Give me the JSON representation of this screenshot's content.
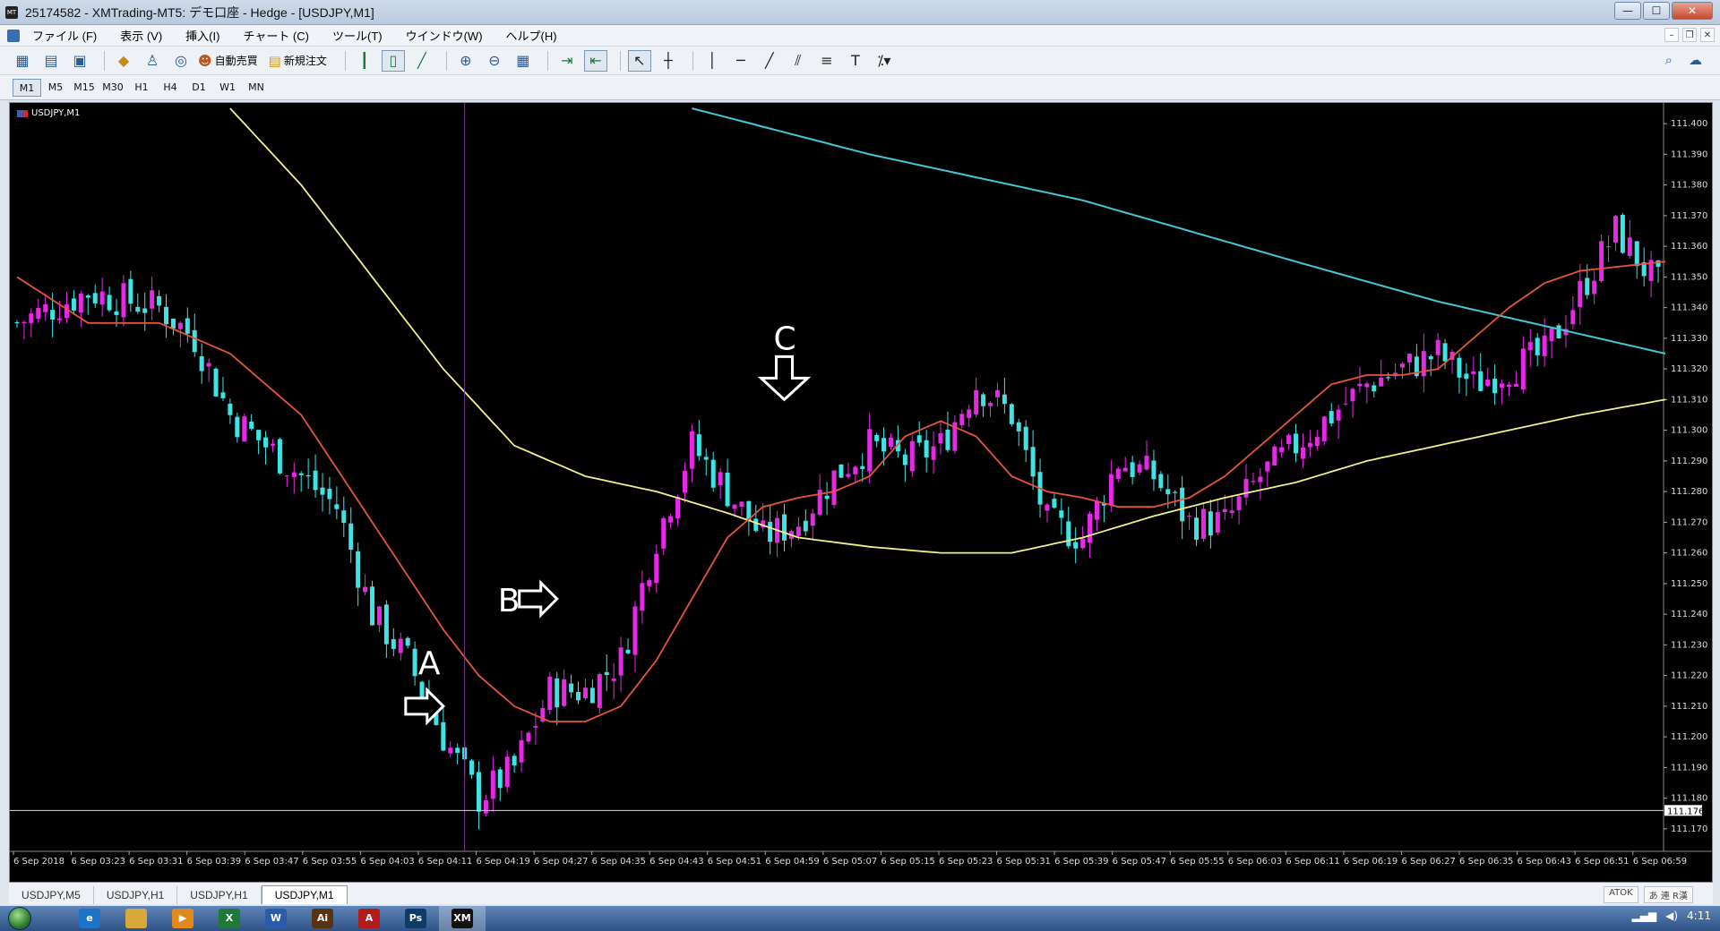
{
  "window": {
    "title": "25174582 - XMTrading-MT5: デモ口座 - Hedge - [USDJPY,M1]",
    "icon": "mt5-icon",
    "buttons": [
      "minimize",
      "maximize",
      "close"
    ]
  },
  "menu": {
    "items": [
      "ファイル (F)",
      "表示 (V)",
      "挿入(I)",
      "チャート (C)",
      "ツール(T)",
      "ウインドウ(W)",
      "ヘルプ(H)"
    ]
  },
  "toolbar": {
    "auto_trade_label": "自動売買",
    "new_order_label": "新規注文"
  },
  "timeframes": {
    "items": [
      "M1",
      "M5",
      "M15",
      "M30",
      "H1",
      "H4",
      "D1",
      "W1",
      "MN"
    ],
    "active": "M1"
  },
  "chart": {
    "label": "USDJPY,M1",
    "current_price": "111.176",
    "colors": {
      "background": "#000000",
      "bull": "#e629e6",
      "bear": "#3ee4e4",
      "ma_fast": "#e8543a",
      "ma_mid": "#f0f08c",
      "ma_slow": "#46c6d8"
    },
    "annotations": [
      {
        "label": "A",
        "arrow": "right"
      },
      {
        "label": "B",
        "arrow": "right"
      },
      {
        "label": "C",
        "arrow": "down"
      }
    ]
  },
  "chart_data": {
    "type": "candlestick",
    "y_range": [
      111.165,
      111.405
    ],
    "y_ticks": [
      "111.400",
      "111.390",
      "111.380",
      "111.370",
      "111.360",
      "111.350",
      "111.340",
      "111.330",
      "111.320",
      "111.310",
      "111.300",
      "111.290",
      "111.280",
      "111.270",
      "111.260",
      "111.250",
      "111.240",
      "111.230",
      "111.220",
      "111.210",
      "111.200",
      "111.190",
      "111.180",
      "111.170"
    ],
    "x_labels": [
      "6 Sep 2018",
      "6 Sep 03:23",
      "6 Sep 03:31",
      "6 Sep 03:39",
      "6 Sep 03:47",
      "6 Sep 03:55",
      "6 Sep 04:03",
      "6 Sep 04:11",
      "6 Sep 04:19",
      "6 Sep 04:27",
      "6 Sep 04:35",
      "6 Sep 04:43",
      "6 Sep 04:51",
      "6 Sep 04:59",
      "6 Sep 05:07",
      "6 Sep 05:15",
      "6 Sep 05:23",
      "6 Sep 05:31",
      "6 Sep 05:39",
      "6 Sep 05:47",
      "6 Sep 05:55",
      "6 Sep 06:03",
      "6 Sep 06:11",
      "6 Sep 06:19",
      "6 Sep 06:27",
      "6 Sep 06:35",
      "6 Sep 06:43",
      "6 Sep 06:51",
      "6 Sep 06:59"
    ],
    "close_trend": [
      [
        0,
        111.335
      ],
      [
        10,
        111.345
      ],
      [
        20,
        111.34
      ],
      [
        25,
        111.33
      ],
      [
        30,
        111.305
      ],
      [
        40,
        111.285
      ],
      [
        45,
        111.275
      ],
      [
        50,
        111.24
      ],
      [
        55,
        111.225
      ],
      [
        60,
        111.2
      ],
      [
        65,
        111.18
      ],
      [
        70,
        111.19
      ],
      [
        75,
        111.215
      ],
      [
        80,
        111.215
      ],
      [
        85,
        111.225
      ],
      [
        90,
        111.265
      ],
      [
        95,
        111.295
      ],
      [
        100,
        111.28
      ],
      [
        105,
        111.265
      ],
      [
        110,
        111.27
      ],
      [
        115,
        111.285
      ],
      [
        120,
        111.295
      ],
      [
        125,
        111.29
      ],
      [
        130,
        111.295
      ],
      [
        135,
        111.315
      ],
      [
        140,
        111.305
      ],
      [
        145,
        111.27
      ],
      [
        150,
        111.265
      ],
      [
        155,
        111.29
      ],
      [
        160,
        111.285
      ],
      [
        165,
        111.27
      ],
      [
        170,
        111.27
      ],
      [
        175,
        111.285
      ],
      [
        180,
        111.295
      ],
      [
        185,
        111.305
      ],
      [
        190,
        111.315
      ],
      [
        195,
        111.32
      ],
      [
        200,
        111.325
      ],
      [
        205,
        111.315
      ],
      [
        210,
        111.32
      ],
      [
        215,
        111.325
      ],
      [
        220,
        111.345
      ],
      [
        225,
        111.365
      ],
      [
        230,
        111.35
      ],
      [
        232,
        111.345
      ]
    ],
    "ma_fast": [
      [
        0,
        111.35
      ],
      [
        10,
        111.335
      ],
      [
        20,
        111.335
      ],
      [
        30,
        111.325
      ],
      [
        40,
        111.305
      ],
      [
        50,
        111.27
      ],
      [
        60,
        111.235
      ],
      [
        65,
        111.22
      ],
      [
        70,
        111.21
      ],
      [
        75,
        111.205
      ],
      [
        80,
        111.205
      ],
      [
        85,
        111.21
      ],
      [
        90,
        111.225
      ],
      [
        95,
        111.245
      ],
      [
        100,
        111.265
      ],
      [
        105,
        111.275
      ],
      [
        110,
        111.278
      ],
      [
        115,
        111.28
      ],
      [
        120,
        111.285
      ],
      [
        125,
        111.298
      ],
      [
        130,
        111.303
      ],
      [
        135,
        111.298
      ],
      [
        140,
        111.285
      ],
      [
        145,
        111.28
      ],
      [
        150,
        111.278
      ],
      [
        155,
        111.275
      ],
      [
        160,
        111.275
      ],
      [
        165,
        111.278
      ],
      [
        170,
        111.285
      ],
      [
        175,
        111.295
      ],
      [
        180,
        111.305
      ],
      [
        185,
        111.315
      ],
      [
        190,
        111.318
      ],
      [
        195,
        111.318
      ],
      [
        200,
        111.32
      ],
      [
        205,
        111.33
      ],
      [
        210,
        111.34
      ],
      [
        215,
        111.348
      ],
      [
        220,
        111.352
      ],
      [
        232,
        111.355
      ]
    ],
    "ma_mid": [
      [
        30,
        111.405
      ],
      [
        40,
        111.38
      ],
      [
        50,
        111.35
      ],
      [
        60,
        111.32
      ],
      [
        70,
        111.295
      ],
      [
        80,
        111.285
      ],
      [
        90,
        111.28
      ],
      [
        100,
        111.273
      ],
      [
        110,
        111.265
      ],
      [
        120,
        111.262
      ],
      [
        130,
        111.26
      ],
      [
        140,
        111.26
      ],
      [
        150,
        111.265
      ],
      [
        160,
        111.272
      ],
      [
        170,
        111.278
      ],
      [
        180,
        111.283
      ],
      [
        190,
        111.29
      ],
      [
        200,
        111.295
      ],
      [
        210,
        111.3
      ],
      [
        220,
        111.305
      ],
      [
        232,
        111.31
      ]
    ],
    "ma_slow": [
      [
        95,
        111.405
      ],
      [
        120,
        111.39
      ],
      [
        150,
        111.375
      ],
      [
        180,
        111.355
      ],
      [
        200,
        111.342
      ],
      [
        232,
        111.325
      ]
    ],
    "annotations": [
      {
        "label": "A",
        "bar": 60,
        "price": 111.21
      },
      {
        "label": "B",
        "bar": 76,
        "price": 111.245
      },
      {
        "label": "C",
        "bar": 108,
        "price": 111.31
      }
    ],
    "current_price": 111.176
  },
  "tabs": {
    "items": [
      "USDJPY,M5",
      "USDJPY,H1",
      "USDJPY,H1",
      "USDJPY,M1"
    ],
    "active_index": 3
  },
  "status": {
    "ime": [
      "ATOK",
      "あ 連 R漢"
    ]
  },
  "taskbar": {
    "apps": [
      {
        "name": "ie-icon",
        "color": "#1f73c6",
        "glyph": "e"
      },
      {
        "name": "explorer-icon",
        "color": "#d7a93a",
        "glyph": ""
      },
      {
        "name": "media-icon",
        "color": "#e08a1c",
        "glyph": "▶"
      },
      {
        "name": "excel-icon",
        "color": "#1e7a34",
        "glyph": "X"
      },
      {
        "name": "word-icon",
        "color": "#2a5caa",
        "glyph": "W"
      },
      {
        "name": "illustrator-icon",
        "color": "#5a3412",
        "glyph": "Ai"
      },
      {
        "name": "acrobat-icon",
        "color": "#b31b1b",
        "glyph": "A"
      },
      {
        "name": "photoshop-icon",
        "color": "#0f3b66",
        "glyph": "Ps"
      },
      {
        "name": "xm-icon",
        "color": "#111111",
        "glyph": "XM"
      }
    ],
    "active_app": 8,
    "clock": "4:11"
  }
}
